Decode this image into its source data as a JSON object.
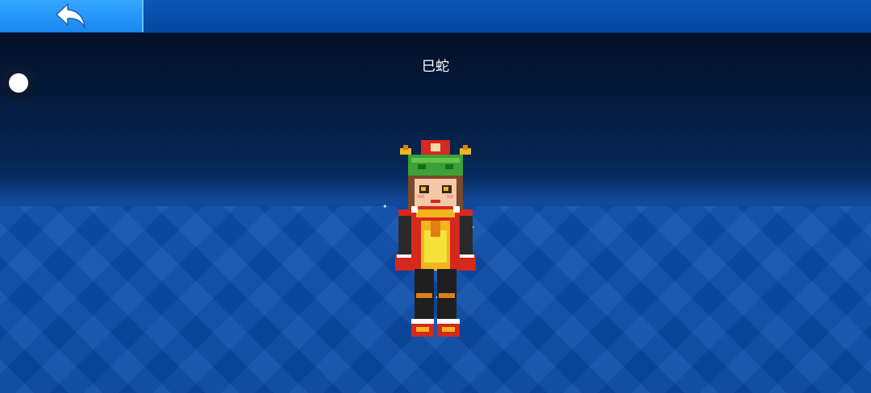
{
  "topbar": {
    "back_icon": "back-arrow-icon"
  },
  "skin": {
    "name": "巳蛇"
  },
  "controls": {
    "toggle_icon": "circle-toggle-icon"
  },
  "colors": {
    "topbar": "#0647a0",
    "back_button": "#1a87f0",
    "floor": "#0a4aa3",
    "outfit_red": "#d6281c",
    "outfit_gold": "#f2b51d",
    "hat_green": "#3aa236"
  }
}
